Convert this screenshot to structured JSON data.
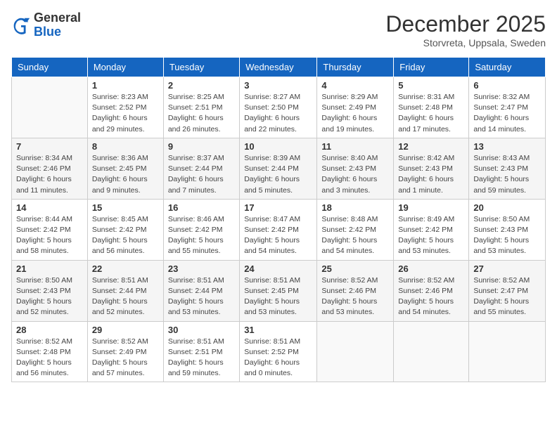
{
  "header": {
    "logo_line1": "General",
    "logo_line2": "Blue",
    "month": "December 2025",
    "location": "Storvreta, Uppsala, Sweden"
  },
  "weekdays": [
    "Sunday",
    "Monday",
    "Tuesday",
    "Wednesday",
    "Thursday",
    "Friday",
    "Saturday"
  ],
  "weeks": [
    [
      {
        "day": "",
        "info": ""
      },
      {
        "day": "1",
        "info": "Sunrise: 8:23 AM\nSunset: 2:52 PM\nDaylight: 6 hours\nand 29 minutes."
      },
      {
        "day": "2",
        "info": "Sunrise: 8:25 AM\nSunset: 2:51 PM\nDaylight: 6 hours\nand 26 minutes."
      },
      {
        "day": "3",
        "info": "Sunrise: 8:27 AM\nSunset: 2:50 PM\nDaylight: 6 hours\nand 22 minutes."
      },
      {
        "day": "4",
        "info": "Sunrise: 8:29 AM\nSunset: 2:49 PM\nDaylight: 6 hours\nand 19 minutes."
      },
      {
        "day": "5",
        "info": "Sunrise: 8:31 AM\nSunset: 2:48 PM\nDaylight: 6 hours\nand 17 minutes."
      },
      {
        "day": "6",
        "info": "Sunrise: 8:32 AM\nSunset: 2:47 PM\nDaylight: 6 hours\nand 14 minutes."
      }
    ],
    [
      {
        "day": "7",
        "info": "Sunrise: 8:34 AM\nSunset: 2:46 PM\nDaylight: 6 hours\nand 11 minutes."
      },
      {
        "day": "8",
        "info": "Sunrise: 8:36 AM\nSunset: 2:45 PM\nDaylight: 6 hours\nand 9 minutes."
      },
      {
        "day": "9",
        "info": "Sunrise: 8:37 AM\nSunset: 2:44 PM\nDaylight: 6 hours\nand 7 minutes."
      },
      {
        "day": "10",
        "info": "Sunrise: 8:39 AM\nSunset: 2:44 PM\nDaylight: 6 hours\nand 5 minutes."
      },
      {
        "day": "11",
        "info": "Sunrise: 8:40 AM\nSunset: 2:43 PM\nDaylight: 6 hours\nand 3 minutes."
      },
      {
        "day": "12",
        "info": "Sunrise: 8:42 AM\nSunset: 2:43 PM\nDaylight: 6 hours\nand 1 minute."
      },
      {
        "day": "13",
        "info": "Sunrise: 8:43 AM\nSunset: 2:43 PM\nDaylight: 5 hours\nand 59 minutes."
      }
    ],
    [
      {
        "day": "14",
        "info": "Sunrise: 8:44 AM\nSunset: 2:42 PM\nDaylight: 5 hours\nand 58 minutes."
      },
      {
        "day": "15",
        "info": "Sunrise: 8:45 AM\nSunset: 2:42 PM\nDaylight: 5 hours\nand 56 minutes."
      },
      {
        "day": "16",
        "info": "Sunrise: 8:46 AM\nSunset: 2:42 PM\nDaylight: 5 hours\nand 55 minutes."
      },
      {
        "day": "17",
        "info": "Sunrise: 8:47 AM\nSunset: 2:42 PM\nDaylight: 5 hours\nand 54 minutes."
      },
      {
        "day": "18",
        "info": "Sunrise: 8:48 AM\nSunset: 2:42 PM\nDaylight: 5 hours\nand 54 minutes."
      },
      {
        "day": "19",
        "info": "Sunrise: 8:49 AM\nSunset: 2:42 PM\nDaylight: 5 hours\nand 53 minutes."
      },
      {
        "day": "20",
        "info": "Sunrise: 8:50 AM\nSunset: 2:43 PM\nDaylight: 5 hours\nand 53 minutes."
      }
    ],
    [
      {
        "day": "21",
        "info": "Sunrise: 8:50 AM\nSunset: 2:43 PM\nDaylight: 5 hours\nand 52 minutes."
      },
      {
        "day": "22",
        "info": "Sunrise: 8:51 AM\nSunset: 2:44 PM\nDaylight: 5 hours\nand 52 minutes."
      },
      {
        "day": "23",
        "info": "Sunrise: 8:51 AM\nSunset: 2:44 PM\nDaylight: 5 hours\nand 53 minutes."
      },
      {
        "day": "24",
        "info": "Sunrise: 8:51 AM\nSunset: 2:45 PM\nDaylight: 5 hours\nand 53 minutes."
      },
      {
        "day": "25",
        "info": "Sunrise: 8:52 AM\nSunset: 2:46 PM\nDaylight: 5 hours\nand 53 minutes."
      },
      {
        "day": "26",
        "info": "Sunrise: 8:52 AM\nSunset: 2:46 PM\nDaylight: 5 hours\nand 54 minutes."
      },
      {
        "day": "27",
        "info": "Sunrise: 8:52 AM\nSunset: 2:47 PM\nDaylight: 5 hours\nand 55 minutes."
      }
    ],
    [
      {
        "day": "28",
        "info": "Sunrise: 8:52 AM\nSunset: 2:48 PM\nDaylight: 5 hours\nand 56 minutes."
      },
      {
        "day": "29",
        "info": "Sunrise: 8:52 AM\nSunset: 2:49 PM\nDaylight: 5 hours\nand 57 minutes."
      },
      {
        "day": "30",
        "info": "Sunrise: 8:51 AM\nSunset: 2:51 PM\nDaylight: 5 hours\nand 59 minutes."
      },
      {
        "day": "31",
        "info": "Sunrise: 8:51 AM\nSunset: 2:52 PM\nDaylight: 6 hours\nand 0 minutes."
      },
      {
        "day": "",
        "info": ""
      },
      {
        "day": "",
        "info": ""
      },
      {
        "day": "",
        "info": ""
      }
    ]
  ]
}
